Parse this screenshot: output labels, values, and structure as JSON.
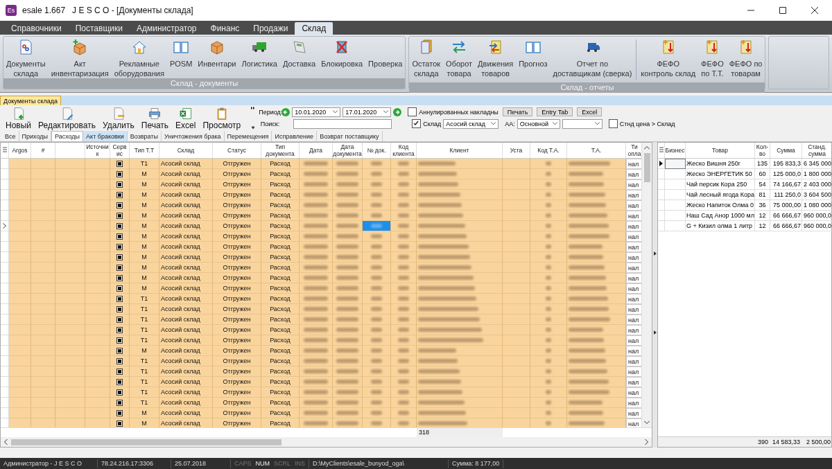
{
  "window": {
    "app_badge": "Es",
    "title": "esale 1.667   J E S C O - [Документы склада]"
  },
  "menu_tabs": [
    {
      "label": "Справочники",
      "selected": false
    },
    {
      "label": "Поставщики",
      "selected": false
    },
    {
      "label": "Администратор",
      "selected": false
    },
    {
      "label": "Финанс",
      "selected": false
    },
    {
      "label": "Продажи",
      "selected": false
    },
    {
      "label": "Склад",
      "selected": true
    }
  ],
  "ribbon_groups": [
    {
      "title": "Склад - документы",
      "buttons": [
        "Документы\nсклада",
        "Акт\nинвентаризация",
        "Рекламные\nоборудования",
        "POSM",
        "Инвентари",
        "Логистика",
        "Доставка",
        "Блокировка",
        "Проверка"
      ]
    },
    {
      "title": "Склад - отчеты",
      "buttons": [
        "Остаток\nсклада",
        "Оборот\nтовара",
        "Движения\nтоваров",
        "Прогноз",
        "Отчет по\nдоставщикам (сверка)",
        "ФЕФО\nконтроль склад",
        "ФЕФО\nпо Т.Т.",
        "ФЕФО по\nтоварам"
      ]
    }
  ],
  "doc_tab": {
    "label": "Документы склада",
    "selected": true
  },
  "toolbar": [
    "Новый",
    "Редактировать",
    "Удалить",
    "Печать",
    "Excel",
    "Просмотр"
  ],
  "filters": {
    "period_label": "Период:",
    "date_from": "10.01.2020",
    "date_to": "17.01.2020",
    "search_label": "Поиск:",
    "annulled": {
      "label": "Аннулированных накладны",
      "checked": false
    },
    "buttons": [
      "Печать",
      "Entry Tab",
      "Excel"
    ],
    "warehouse": {
      "label": "Склад",
      "checked": true,
      "value": "Асосий склад"
    },
    "aa": {
      "label": "АА:",
      "value": "Основной"
    },
    "std_price": {
      "label": "Стнд цена > Склад",
      "checked": false
    }
  },
  "doc_type_tabs": [
    {
      "label": "Все",
      "selected": false,
      "highlighted": false
    },
    {
      "label": "Приходы",
      "selected": false,
      "highlighted": false
    },
    {
      "label": "Расходы",
      "selected": true,
      "highlighted": false
    },
    {
      "label": "Акт браковки",
      "selected": false,
      "highlighted": true
    },
    {
      "label": "Возвраты",
      "selected": false,
      "highlighted": false
    },
    {
      "label": "Уничтожения брака",
      "selected": false,
      "highlighted": false
    },
    {
      "label": "Перемещения",
      "selected": false,
      "highlighted": false
    },
    {
      "label": "Исправление",
      "selected": false,
      "highlighted": false
    },
    {
      "label": "Возврат поставщику",
      "selected": false,
      "highlighted": false
    }
  ],
  "main_table": {
    "columns": [
      {
        "label": "Argos",
        "kind": "empty"
      },
      {
        "label": "#",
        "kind": "empty"
      },
      {
        "kind": "empty"
      },
      {
        "label": "Источни\nк",
        "kind": "empty"
      },
      {
        "label": "Серв\nис",
        "kind": "check"
      },
      {
        "label": "Тип Т.Т",
        "kind": "text"
      },
      {
        "label": "Склад",
        "kind": "text"
      },
      {
        "label": "Статус",
        "kind": "text"
      },
      {
        "label": "Тип\nдокумента",
        "kind": "text"
      },
      {
        "label": "Дата",
        "kind": "blurred"
      },
      {
        "label": "Дата\nдокумента",
        "kind": "blurred"
      },
      {
        "label": "№ док.",
        "kind": "blurred"
      },
      {
        "label": "Код\nклиента",
        "kind": "blurred"
      },
      {
        "label": "Клиент",
        "kind": "blurred"
      },
      {
        "label": "Уста",
        "kind": "empty"
      },
      {
        "label": "Код Т.А.",
        "kind": "blurred"
      },
      {
        "label": "Т.А.",
        "kind": "blurred"
      },
      {
        "label": "Ти\nопла",
        "kind": "text"
      }
    ],
    "rows": [
      {
        "type_tt": "T1",
        "warehouse": "Асосий склад",
        "status": "Отгружен",
        "doc_type": "Расход",
        "payment": "нал",
        "service": true,
        "current": false
      },
      {
        "type_tt": "M",
        "warehouse": "Асосий склад",
        "status": "Отгружен",
        "doc_type": "Расход",
        "payment": "нал",
        "service": true,
        "current": false
      },
      {
        "type_tt": "M",
        "warehouse": "Асосий склад",
        "status": "Отгружен",
        "doc_type": "Расход",
        "payment": "нал",
        "service": true,
        "current": false
      },
      {
        "type_tt": "M",
        "warehouse": "Асосий склад",
        "status": "Отгружен",
        "doc_type": "Расход",
        "payment": "нал",
        "service": true,
        "current": false
      },
      {
        "type_tt": "M",
        "warehouse": "Асосий склад",
        "status": "Отгружен",
        "doc_type": "Расход",
        "payment": "нал",
        "service": true,
        "current": false
      },
      {
        "type_tt": "M",
        "warehouse": "Асосий склад",
        "status": "Отгружен",
        "doc_type": "Расход",
        "payment": "нал",
        "service": true,
        "current": false
      },
      {
        "type_tt": "M",
        "warehouse": "Асосий склад",
        "status": "Отгружен",
        "doc_type": "Расход",
        "payment": "нал",
        "service": true,
        "current": true
      },
      {
        "type_tt": "M",
        "warehouse": "Асосий склад",
        "status": "Отгружен",
        "doc_type": "Расход",
        "payment": "нал",
        "service": true,
        "current": false
      },
      {
        "type_tt": "M",
        "warehouse": "Асосий склад",
        "status": "Отгружен",
        "doc_type": "Расход",
        "payment": "нал",
        "service": true,
        "current": false
      },
      {
        "type_tt": "M",
        "warehouse": "Асосий склад",
        "status": "Отгружен",
        "doc_type": "Расход",
        "payment": "нал",
        "service": true,
        "current": false
      },
      {
        "type_tt": "M",
        "warehouse": "Асосий склад",
        "status": "Отгружен",
        "doc_type": "Расход",
        "payment": "нал",
        "service": true,
        "current": false
      },
      {
        "type_tt": "M",
        "warehouse": "Асосий склад",
        "status": "Отгружен",
        "doc_type": "Расход",
        "payment": "нал",
        "service": true,
        "current": false
      },
      {
        "type_tt": "M",
        "warehouse": "Асосий склад",
        "status": "Отгружен",
        "doc_type": "Расход",
        "payment": "нал",
        "service": true,
        "current": false
      },
      {
        "type_tt": "T1",
        "warehouse": "Асосий склад",
        "status": "Отгружен",
        "doc_type": "Расход",
        "payment": "нал",
        "service": true,
        "current": false
      },
      {
        "type_tt": "T1",
        "warehouse": "Асосий склад",
        "status": "Отгружен",
        "doc_type": "Расход",
        "payment": "нал",
        "service": true,
        "current": false
      },
      {
        "type_tt": "T1",
        "warehouse": "Асосий склад",
        "status": "Отгружен",
        "doc_type": "Расход",
        "payment": "нал",
        "service": true,
        "current": false
      },
      {
        "type_tt": "T1",
        "warehouse": "Асосий склад",
        "status": "Отгружен",
        "doc_type": "Расход",
        "payment": "нал",
        "service": true,
        "current": false
      },
      {
        "type_tt": "T1",
        "warehouse": "Асосий склад",
        "status": "Отгружен",
        "doc_type": "Расход",
        "payment": "нал",
        "service": true,
        "current": false
      },
      {
        "type_tt": "M",
        "warehouse": "Асосий склад",
        "status": "Отгружен",
        "doc_type": "Расход",
        "payment": "нал",
        "service": true,
        "current": false
      },
      {
        "type_tt": "T1",
        "warehouse": "Асосий склад",
        "status": "Отгружен",
        "doc_type": "Расход",
        "payment": "нал",
        "service": true,
        "current": false
      },
      {
        "type_tt": "T1",
        "warehouse": "Асосий склад",
        "status": "Отгружен",
        "doc_type": "Расход",
        "payment": "нал",
        "service": true,
        "current": false
      },
      {
        "type_tt": "T1",
        "warehouse": "Асосий склад",
        "status": "Отгружен",
        "doc_type": "Расход",
        "payment": "нал",
        "service": true,
        "current": false
      },
      {
        "type_tt": "T1",
        "warehouse": "Асосий склад",
        "status": "Отгружен",
        "doc_type": "Расход",
        "payment": "нал",
        "service": true,
        "current": false
      },
      {
        "type_tt": "T1",
        "warehouse": "Асосий склад",
        "status": "Отгружен",
        "doc_type": "Расход",
        "payment": "нал",
        "service": true,
        "current": false
      },
      {
        "type_tt": "M",
        "warehouse": "Асосий склад",
        "status": "Отгружен",
        "doc_type": "Расход",
        "payment": "нал",
        "service": true,
        "current": false
      },
      {
        "type_tt": "M",
        "warehouse": "Асосий склад",
        "status": "Отгружен",
        "doc_type": "Расход",
        "payment": "нал",
        "service": true,
        "current": false
      }
    ],
    "footer_count": "318"
  },
  "products_table": {
    "columns": [
      "Бизнес",
      "Товар",
      "Кол-\nво",
      "Сумма",
      "Станд.\nсумма"
    ],
    "rows": [
      {
        "product": "Жеско  Вишня 250г",
        "qty": "135",
        "sum": "195 833,3",
        "std_sum": "6 345 000",
        "current": true
      },
      {
        "product": "Жеско ЭНЕРГЕТИК  50",
        "qty": "60",
        "sum": "125 000,0",
        "std_sum": "1 800 000",
        "current": false
      },
      {
        "product": "Чай персик Кора 250",
        "qty": "54",
        "sum": "74 166,67",
        "std_sum": "2 403 000",
        "current": false
      },
      {
        "product": "Чай лесный ягода Кора",
        "qty": "81",
        "sum": "111 250,0",
        "std_sum": "3 604 500",
        "current": false
      },
      {
        "product": "Жеско Напиток Олма 0",
        "qty": "36",
        "sum": "75 000,00",
        "std_sum": "1 080 000",
        "current": false
      },
      {
        "product": "Наш Сад Анор 1000 мл",
        "qty": "12",
        "sum": "66 666,67",
        "std_sum": "960 000,0",
        "current": false
      },
      {
        "product": "G + Кизил олма 1 литр",
        "qty": "12",
        "sum": "66 666,67",
        "std_sum": "960 000,0",
        "current": false
      }
    ],
    "totals": [
      "390",
      "14 583,33",
      "2 500,00"
    ]
  },
  "status_bar": {
    "user": "Администратор - J E S C O",
    "server": "78.24.216.17:3306",
    "date": "25.07.2018",
    "keys": [
      {
        "label": "CAPS",
        "on": false
      },
      {
        "label": "NUM",
        "on": true
      },
      {
        "label": "SCRL",
        "on": false
      },
      {
        "label": "INS",
        "on": false
      }
    ],
    "path": "D:\\MyClients\\esale_bunyod_oga\\",
    "total": "Сумма: 8 177,00"
  }
}
